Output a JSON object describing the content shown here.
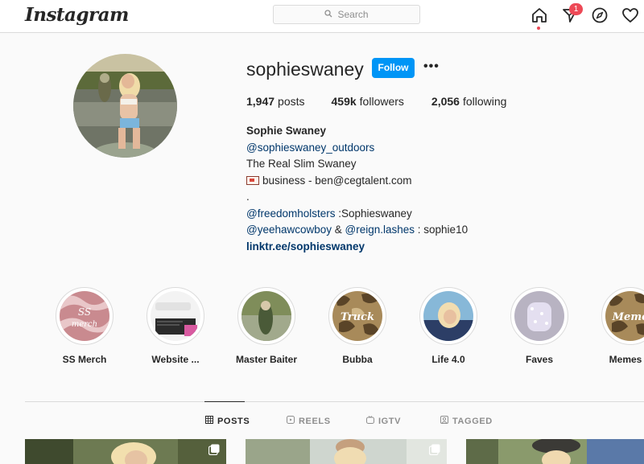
{
  "header": {
    "logo": "Instagram",
    "search_placeholder": "Search",
    "notification_count": "1"
  },
  "profile": {
    "username": "sophieswaney",
    "follow_label": "Follow",
    "more_label": "•••",
    "stats": {
      "posts_count": "1,947",
      "posts_label": "posts",
      "followers_count": "459k",
      "followers_label": "followers",
      "following_count": "2,056",
      "following_label": "following"
    },
    "bio": {
      "full_name": "Sophie Swaney",
      "line1": "@sophieswaney_outdoors",
      "line2": "The Real Slim Swaney",
      "line3": "business - ben@cegtalent.com",
      "line4": ".",
      "line5_link": "@freedomholsters",
      "line5_text": " :Sophieswaney",
      "line6_link1": "@yeehawcowboy",
      "line6_sep": " & ",
      "line6_link2": "@reign.lashes",
      "line6_text": " : sophie10",
      "url": "linktr.ee/sophieswaney"
    }
  },
  "highlights": [
    {
      "label": "SS Merch"
    },
    {
      "label": "Website ..."
    },
    {
      "label": "Master Baiter"
    },
    {
      "label": "Bubba"
    },
    {
      "label": "Life 4.0"
    },
    {
      "label": "Faves"
    },
    {
      "label": "Memes"
    }
  ],
  "tabs": [
    {
      "label": "POSTS",
      "active": true
    },
    {
      "label": "REELS",
      "active": false
    },
    {
      "label": "IGTV",
      "active": false
    },
    {
      "label": "TAGGED",
      "active": false
    }
  ],
  "icons": {
    "home": "home-icon",
    "direct": "direct-message-icon",
    "explore": "compass-icon",
    "activity": "heart-icon",
    "search": "search-icon"
  },
  "colors": {
    "accent": "#0095f6",
    "badge": "#ed4956",
    "link": "#00376b"
  }
}
